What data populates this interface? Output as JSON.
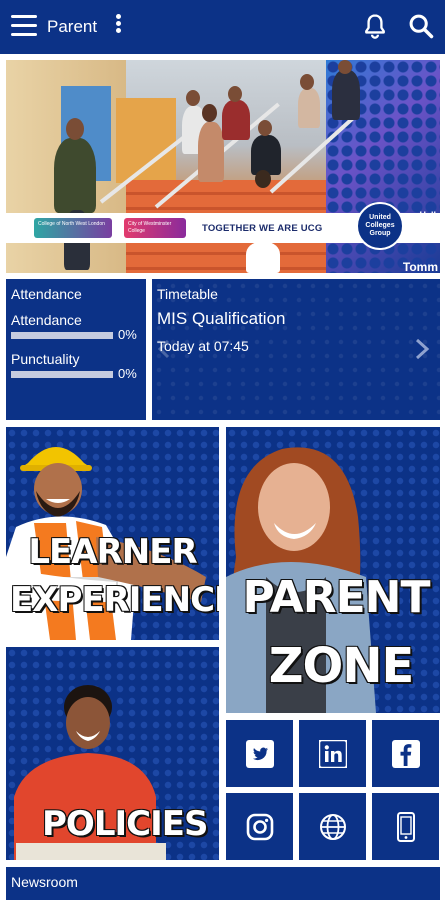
{
  "appbar": {
    "title": "Parent",
    "icons": [
      "menu-icon",
      "more-vert-icon",
      "bell-icon",
      "search-icon"
    ]
  },
  "hero": {
    "ribbon_text": "TOGETHER WE ARE UCG",
    "logo1_text": "College of North West London",
    "logo2_text": "City of Westminster College",
    "seal_text": "United Colleges Group",
    "side_text": "Hall",
    "side_text2": "Tomm"
  },
  "attendance": {
    "title": "Attendance",
    "rows": [
      {
        "label": "Attendance",
        "value": "0%",
        "fraction": 0
      },
      {
        "label": "Punctuality",
        "value": "0%",
        "fraction": 0
      }
    ]
  },
  "timetable": {
    "title": "Timetable",
    "qualification": "MIS Qualification",
    "time": "Today at 07:45"
  },
  "tiles": {
    "learner": [
      "LEARNER",
      "EXPERIENCE"
    ],
    "parent": [
      "PARENT",
      "ZONE"
    ],
    "policies": "POLICIES"
  },
  "social": [
    "twitter-icon",
    "linkedin-icon",
    "facebook-icon",
    "instagram-icon",
    "globe-icon",
    "mobile-phone-icon"
  ],
  "newsroom": {
    "title": "Newsroom"
  },
  "colors": {
    "primary": "#0c3287",
    "bar_track": "#c5cbe0",
    "accent_yellow": "#f2c400"
  }
}
